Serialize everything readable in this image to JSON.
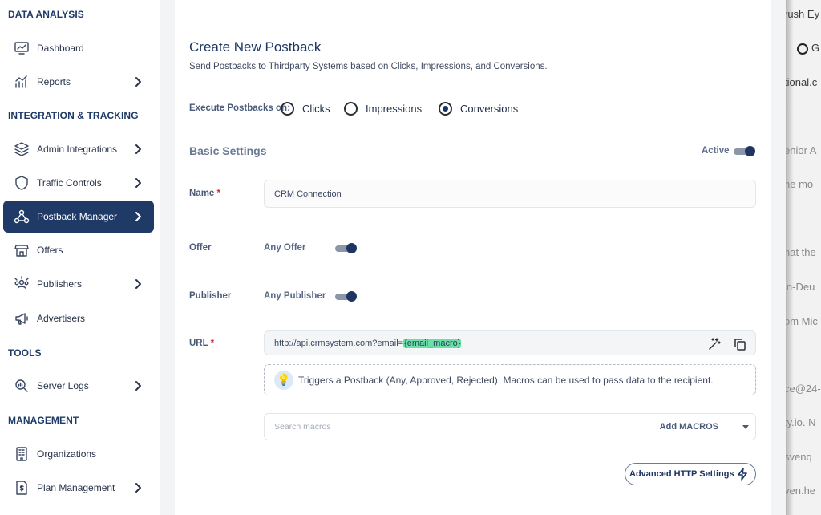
{
  "sidebar": {
    "sections": {
      "data_analysis": "DATA ANALYSIS",
      "integration": "INTEGRATION & TRACKING",
      "tools": "TOOLS",
      "management": "MANAGEMENT"
    },
    "items": {
      "dashboard": "Dashboard",
      "reports": "Reports",
      "admin_integrations": "Admin Integrations",
      "traffic_controls": "Traffic Controls",
      "postback_manager": "Postback Manager",
      "offers": "Offers",
      "publishers": "Publishers",
      "advertisers": "Advertisers",
      "server_logs": "Server Logs",
      "organizations": "Organizations",
      "plan_management": "Plan Management"
    }
  },
  "form": {
    "title": "Create New Postback",
    "subtitle": "Send Postbacks to Thirdparty Systems based on Clicks, Impressions, and Conversions.",
    "execute_label": "Execute Postbacks on:",
    "options": {
      "clicks": "Clicks",
      "impressions": "Impressions",
      "conversions": "Conversions"
    },
    "selected_option": "Conversions",
    "basic_settings": "Basic Settings",
    "active_label": "Active",
    "active_on": true,
    "name_label": "Name",
    "name_value": "CRM Connection",
    "offer_label": "Offer",
    "offer_value": "Any Offer",
    "offer_on": true,
    "publisher_label": "Publisher",
    "publisher_value": "Any Publisher",
    "publisher_on": true,
    "url_label": "URL",
    "url_prefix": "http://api.crmsystem.com?email=",
    "url_macro": "{email_macro}",
    "required_mark": "*",
    "hint": "Triggers a Postback (Any, Approved, Rejected). Macros can be used to pass data to the recipient.",
    "search_macros_placeholder": "Search macros",
    "add_macros": "Add MACROS",
    "advanced_button": "Advanced HTTP Settings"
  },
  "background_page": {
    "fragments": [
      "rush Ey",
      "G",
      "tional.c",
      "enior A",
      "ne mo",
      "nat the",
      "in-Deu",
      "om Mic",
      "ce@24-",
      "ty.io. N",
      "svenq",
      "ven.he"
    ]
  },
  "colors": {
    "accent": "#1f3a66",
    "macro_highlight": "#6be0a6",
    "required": "#d62b2b"
  }
}
